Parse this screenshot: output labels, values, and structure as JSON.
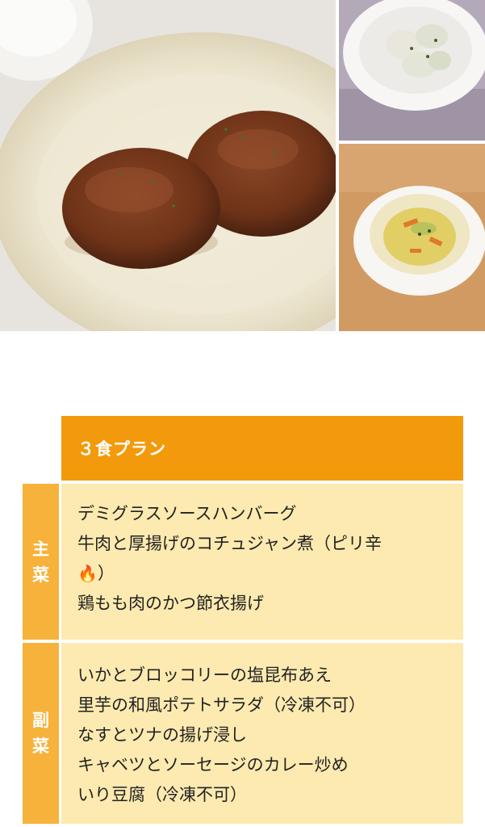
{
  "gallery": {
    "main_photo": "hamburg-steak-photo",
    "side_photo_top": "squid-broccoli-photo",
    "side_photo_bottom": "cabbage-curry-photo"
  },
  "plan": {
    "title": "３食プラン",
    "categories": [
      {
        "label_chars": [
          "主",
          "菜"
        ],
        "items": [
          "デミグラスソースハンバーグ",
          "牛肉と厚揚げのコチュジャン煮（ピリ辛",
          "）",
          "鶏もも肉のかつ節衣揚げ"
        ],
        "spicy_icon": "🔥"
      },
      {
        "label_chars": [
          "副",
          "菜"
        ],
        "items": [
          "いかとブロッコリーの塩昆布あえ",
          "里芋の和風ポテトサラダ（冷凍不可）",
          "なすとツナの揚げ浸し",
          "キャベツとソーセージのカレー炒め",
          "いり豆腐（冷凍不可）"
        ]
      }
    ]
  },
  "colors": {
    "header_bg": "#f39a0c",
    "category_bg": "#f6b23a",
    "items_bg": "#fdeab0"
  }
}
